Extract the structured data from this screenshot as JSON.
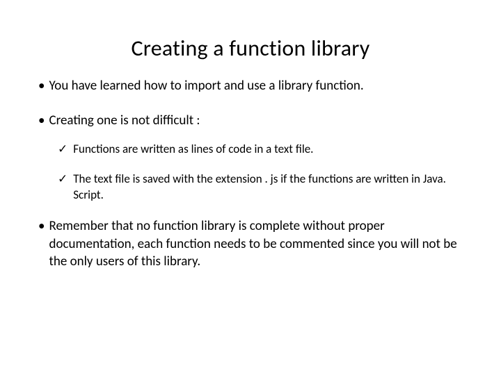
{
  "title": "Creating a function library",
  "bullets": {
    "b1": "You have learned how to import and use a library function.",
    "b2": "Creating one is not difficult :",
    "b3": "Remember that no function library is complete without proper documentation, each function needs to be commented since you will not be the only users of this library."
  },
  "checks": {
    "c1": "Functions are written as lines of code in a text file.",
    "c2": "The text file is saved with the extension . js if the functions are written in Java. Script."
  },
  "symbols": {
    "bullet": "•",
    "check": "✓"
  }
}
